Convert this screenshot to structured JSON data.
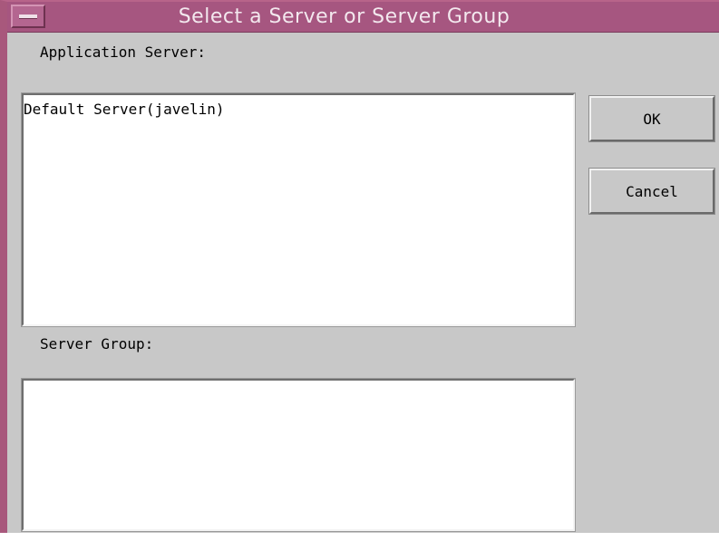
{
  "window": {
    "title": "Select a Server or Server Group"
  },
  "app_server": {
    "label": "Application Server:",
    "items": [
      "Default Server(javelin)"
    ]
  },
  "server_group": {
    "label": "Server Group:",
    "items": []
  },
  "buttons": {
    "ok": "OK",
    "cancel": "Cancel"
  },
  "colors": {
    "titlebar": "#a65680",
    "dialog_bg": "#c8c8c8",
    "list_bg": "#ffffff"
  },
  "icons": {
    "window_menu": "window-menu-icon"
  }
}
